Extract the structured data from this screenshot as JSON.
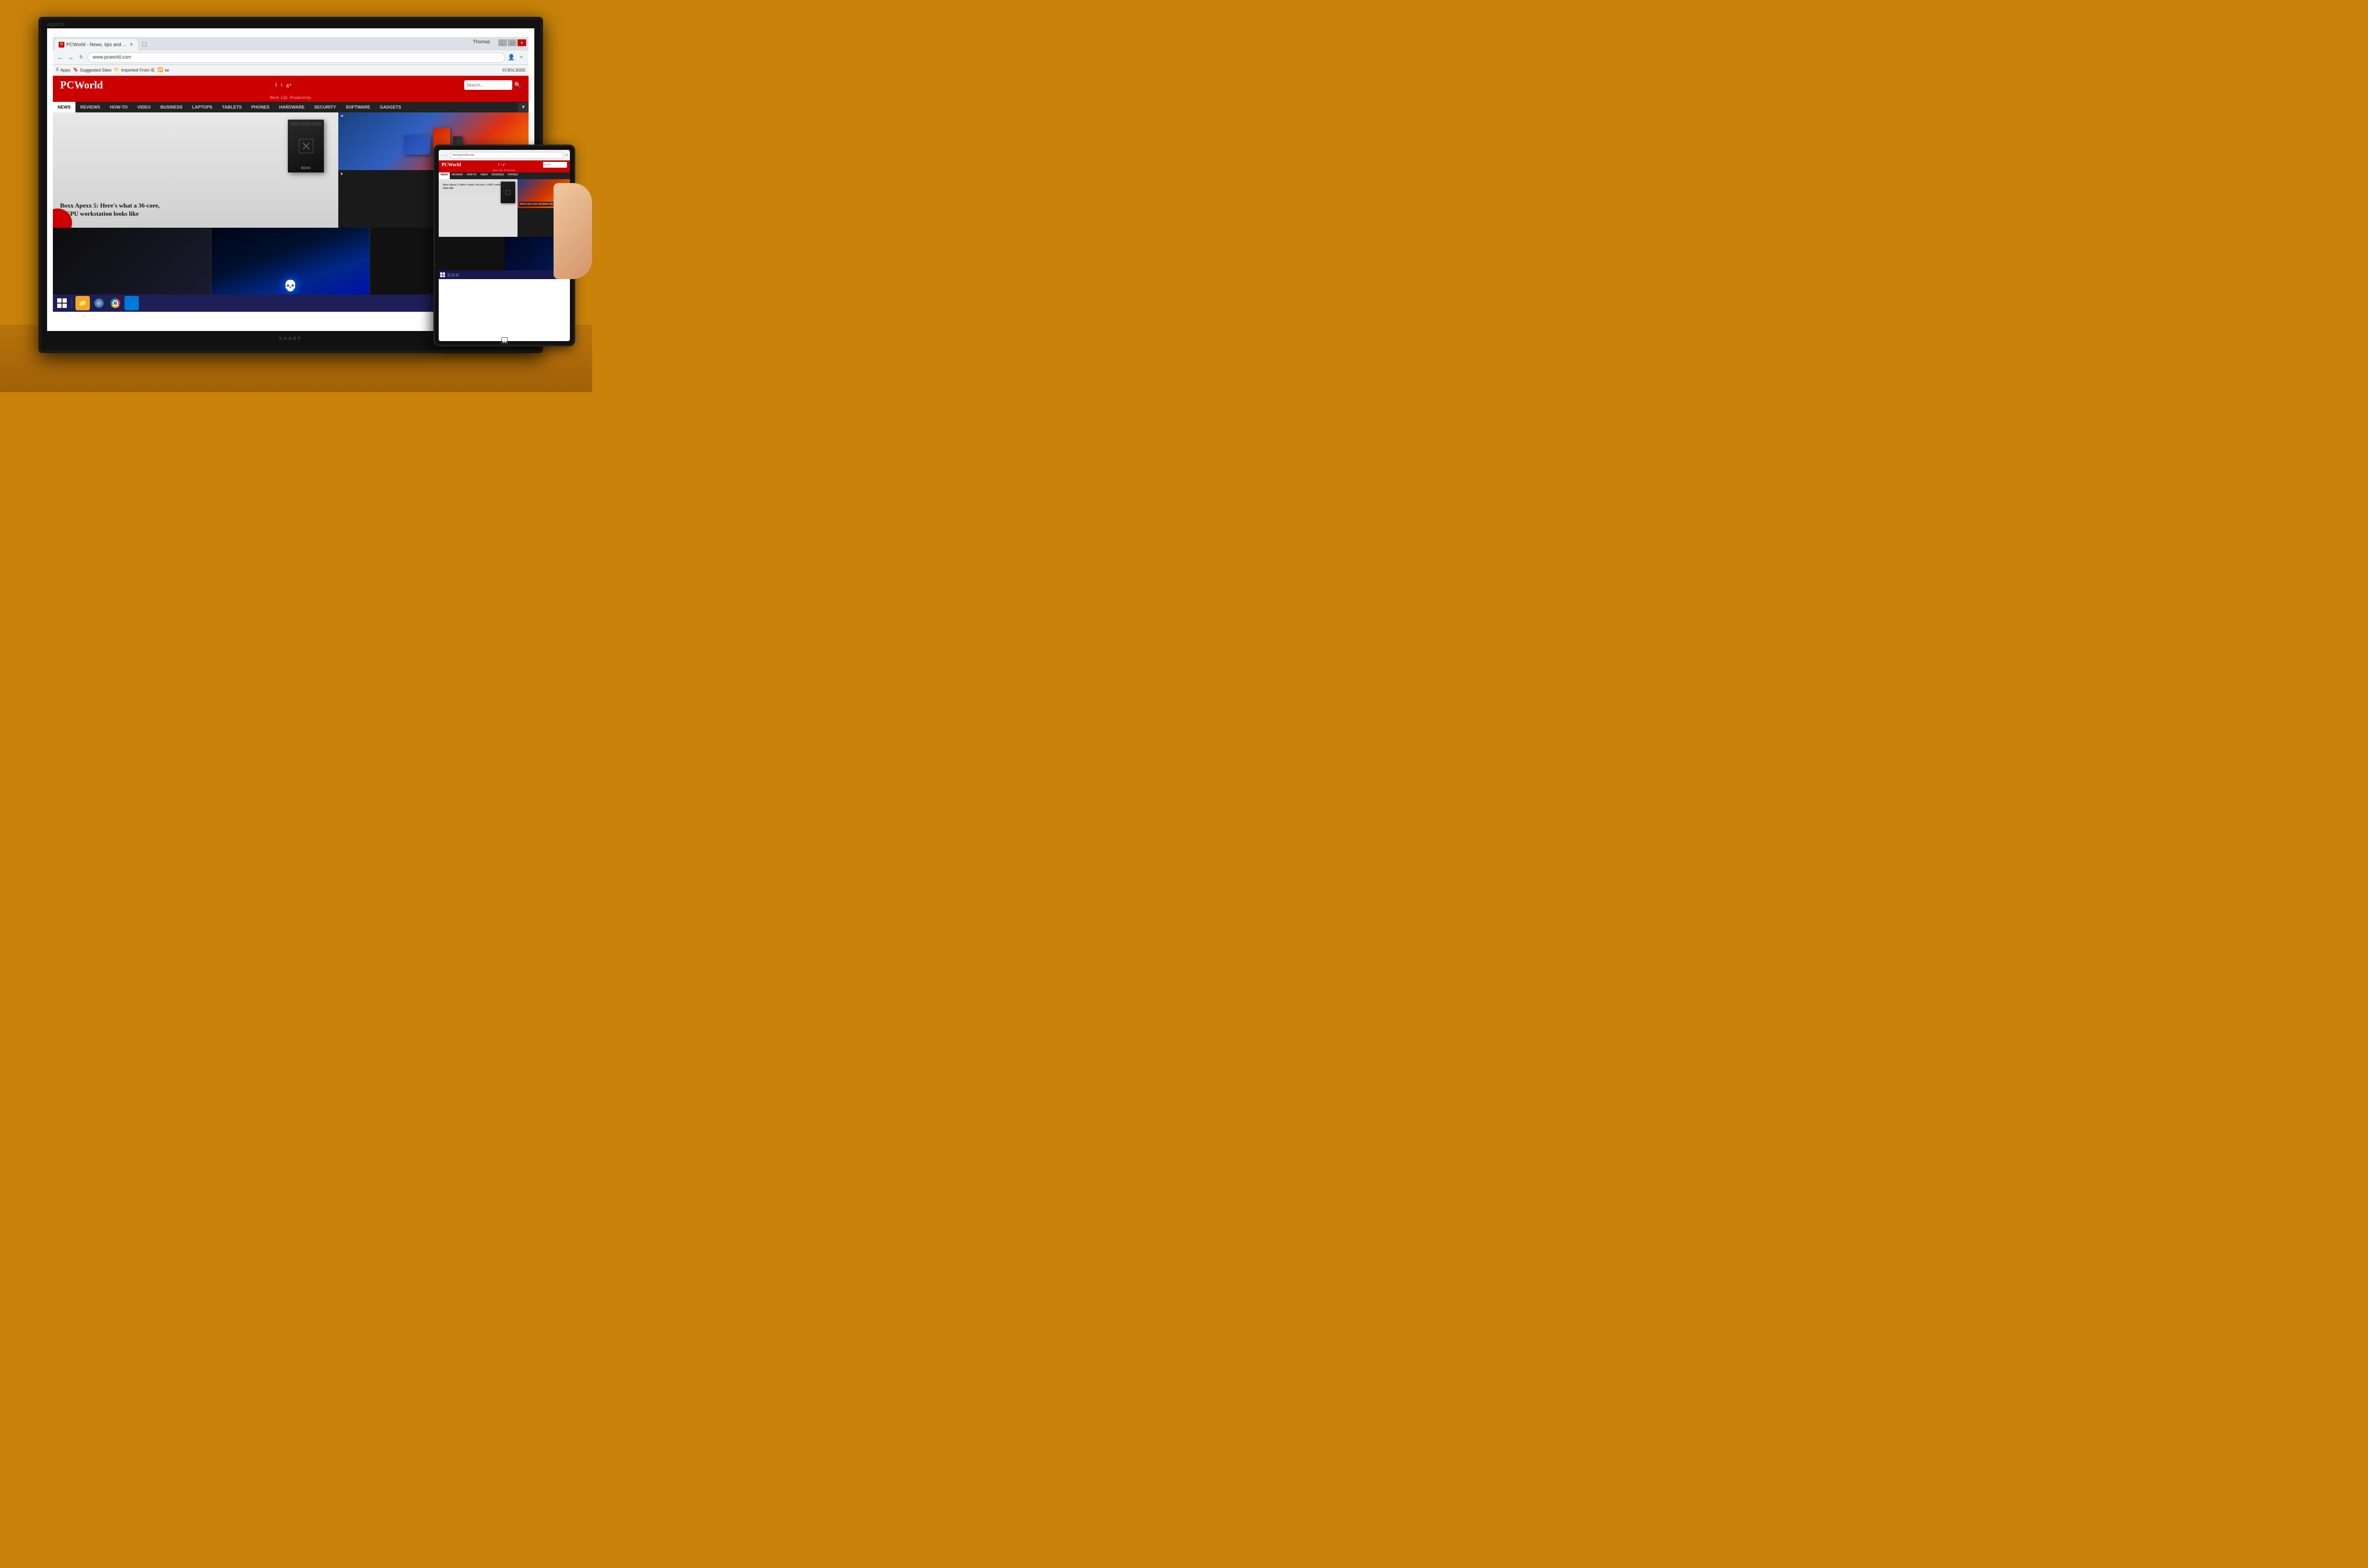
{
  "scene": {
    "background_color": "#c8820a",
    "table_color": "#b8740a"
  },
  "tv": {
    "brand": "SHARP",
    "model_label": "AQUOS",
    "label": "SHARP"
  },
  "browser": {
    "tab_title": "PCWorld - News, tips and ...",
    "tab_favicon": "⏻",
    "url": "www.pcworld.com",
    "user_label": "Thomas",
    "bookmarks": {
      "apps": "Apps",
      "suggested_sites": "Suggested Sites",
      "imported_from_ie": "Imported From IE",
      "se": "se"
    },
    "subscribe_label": "SUBSCRIBE"
  },
  "pcworld": {
    "logo": "PCWorld",
    "tagline": "Work. Life. Productivity.",
    "nav_items": [
      "NEWS",
      "REVIEWS",
      "HOW-TO",
      "VIDEO",
      "BUSINESS",
      "LAPTOPS",
      "TABLETS",
      "PHONES",
      "HARDWARE",
      "SECURITY",
      "SOFTWARE",
      "GADGETS"
    ],
    "active_nav": "NEWS",
    "hero_headline": "Boxx Apexx 5: Here's what a 36-core, 5-GPU workstation looks like",
    "side_article_label": "H",
    "bottom_article_label": "b"
  },
  "taskbar": {
    "icons": [
      "start",
      "folder",
      "steam",
      "chrome",
      "gear"
    ]
  },
  "tablet": {
    "pcworld_logo": "PCWorld",
    "tagline": "Work. Life. Productivity.",
    "hero_headline": "Boxx Apexx 5: Here's what a 36-core, 5-GPU workstation looks like",
    "side_headline": "How to turn your old phone into a basic PC"
  }
}
